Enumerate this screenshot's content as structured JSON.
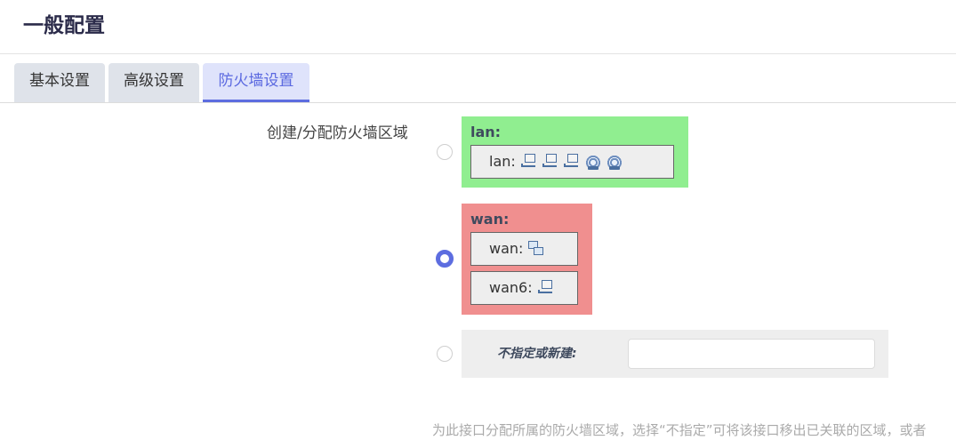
{
  "page": {
    "title": "一般配置"
  },
  "tabs": [
    {
      "label": "基本设置",
      "active": false
    },
    {
      "label": "高级设置",
      "active": false
    },
    {
      "label": "防火墙设置",
      "active": true
    }
  ],
  "firewall": {
    "field_label": "创建/分配防火墙区域",
    "zones": [
      {
        "name": "lan:",
        "color": "#90ee90",
        "selected": false,
        "interfaces": [
          {
            "name": "lan:",
            "icons": [
              "wired-ethernet-icon",
              "wired-ethernet-icon",
              "wired-ethernet-icon",
              "wireless-icon",
              "wireless-icon"
            ]
          }
        ]
      },
      {
        "name": "wan:",
        "color": "#f08f8f",
        "selected": true,
        "interfaces": [
          {
            "name": "wan:",
            "icons": [
              "network-icon"
            ]
          },
          {
            "name": "wan6:",
            "icons": [
              "wired-ethernet-icon"
            ]
          }
        ]
      }
    ],
    "unspecified": {
      "label": "不指定或新建:",
      "value": "",
      "selected": false
    },
    "help_text": "为此接口分配所属的防火墙区域，选择“不指定”可将该接口移出已关联的区域，或者"
  },
  "colors": {
    "accent": "#5d6de0",
    "lan_zone": "#90ee90",
    "wan_zone": "#f08f8f"
  }
}
